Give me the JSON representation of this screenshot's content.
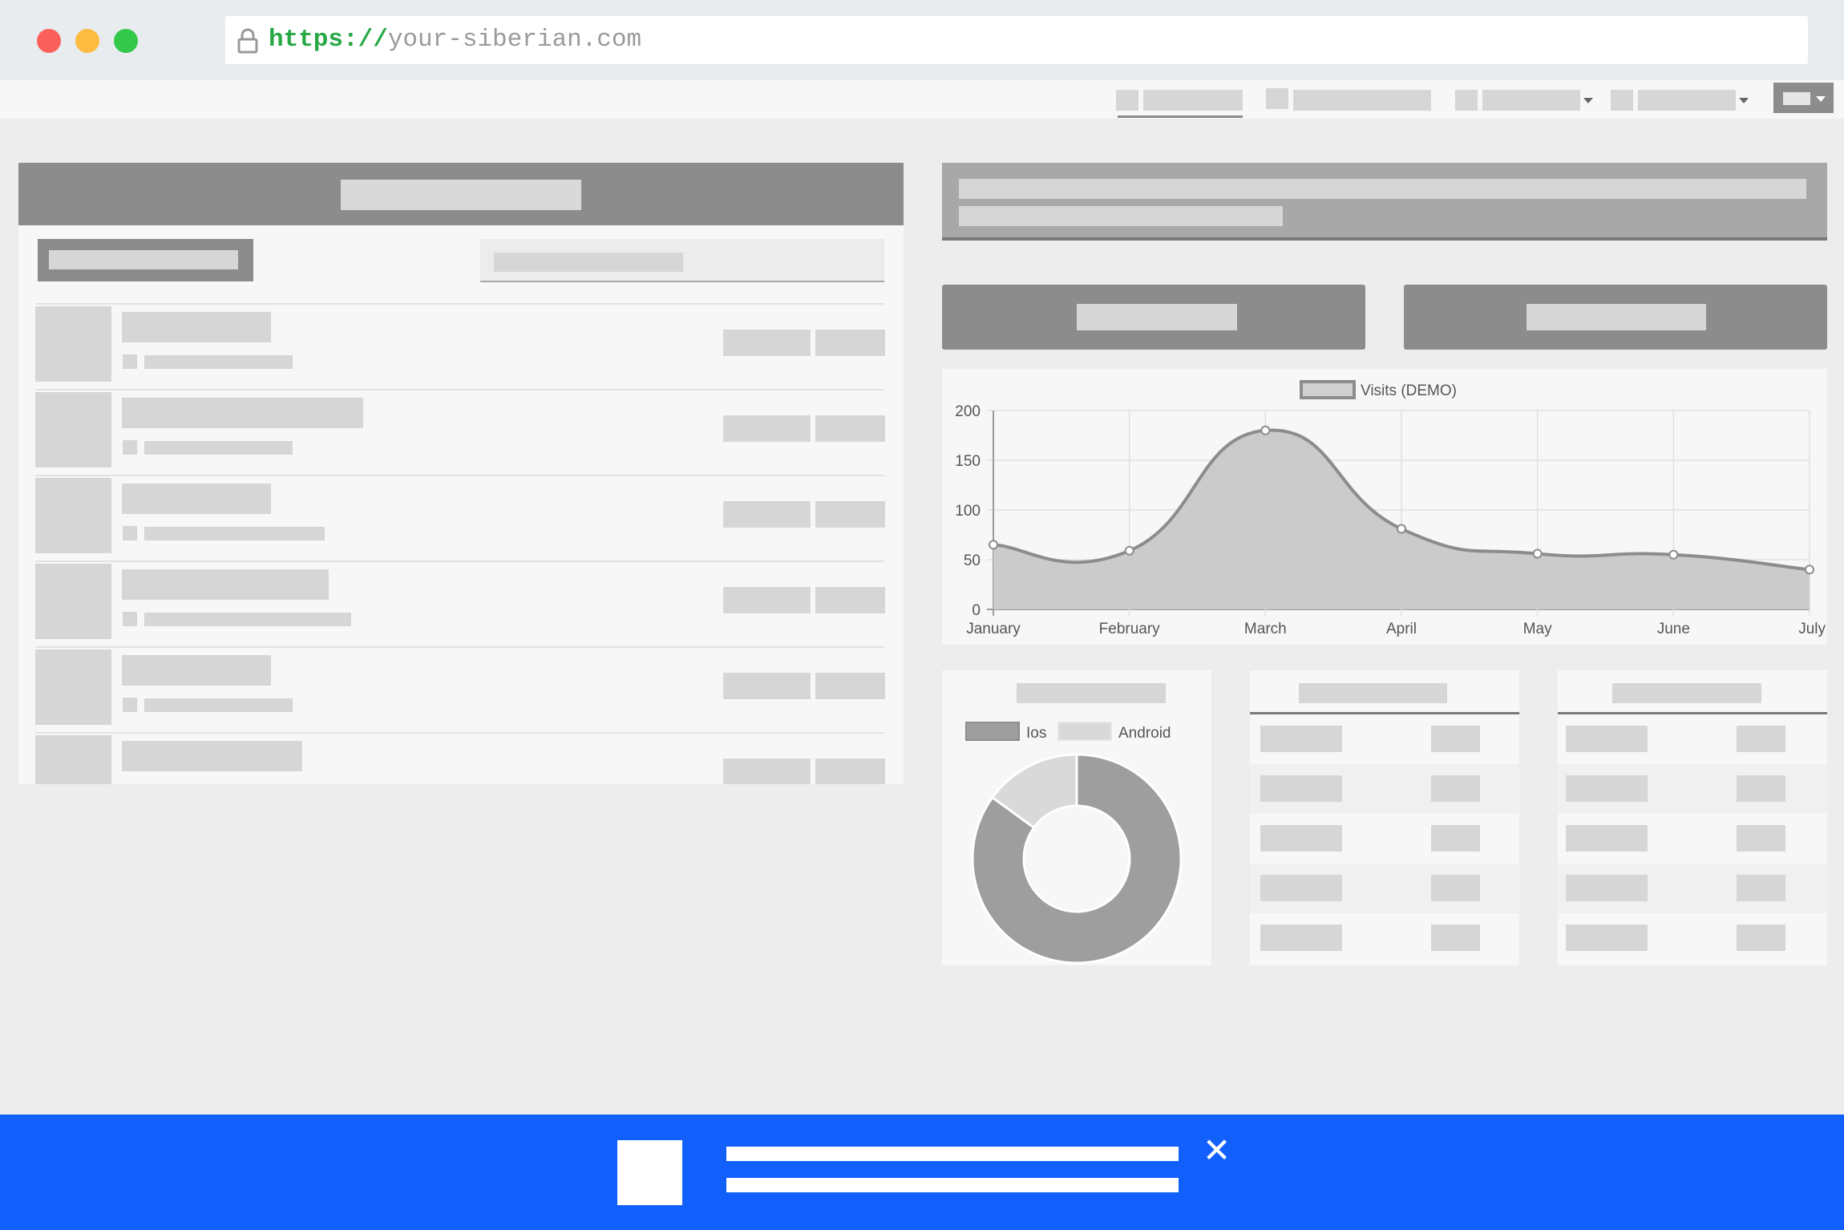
{
  "browser": {
    "url_scheme": "https://",
    "url_host": "your-siberian.com",
    "window_buttons": {
      "close_color": "#fc605c",
      "minimize_color": "#fdbc40",
      "zoom_color": "#34c84a"
    },
    "lock_icon": "lock-icon"
  },
  "banner": {
    "color": "#1260fc",
    "close_glyph": "✕"
  },
  "visits_chart": {
    "legend_label": "Visits (DEMO)",
    "y_ticks": [
      "200",
      "150",
      "100",
      "50",
      "0"
    ]
  },
  "platform_chart": {
    "legend": [
      "Ios",
      "Android"
    ]
  },
  "chart_data": [
    {
      "type": "area",
      "title": "",
      "xlabel": "",
      "ylabel": "",
      "categories": [
        "January",
        "February",
        "March",
        "April",
        "May",
        "June",
        "July"
      ],
      "series": [
        {
          "name": "Visits (DEMO)",
          "values": [
            65,
            59,
            180,
            81,
            56,
            55,
            40
          ]
        }
      ],
      "ylim": [
        0,
        200
      ],
      "y_ticks": [
        0,
        50,
        100,
        150,
        200
      ],
      "grid": true,
      "legend": "top-center",
      "colors": {
        "line": "#8c8c8c",
        "fill": "#cbcbcb"
      }
    },
    {
      "type": "pie",
      "donut": true,
      "categories": [
        "Ios",
        "Android"
      ],
      "values": [
        85,
        15
      ],
      "legend": "top",
      "colors": {
        "Ios": "#9e9e9e",
        "Android": "#d9d9d9"
      }
    }
  ]
}
